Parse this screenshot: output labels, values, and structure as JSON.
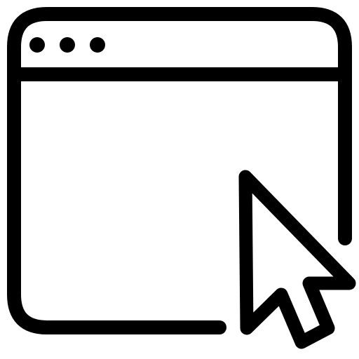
{
  "icon": {
    "name": "browser-window-with-cursor-icon",
    "stroke_color": "#000000",
    "background_color": "#ffffff",
    "window_control_dots": 3
  }
}
